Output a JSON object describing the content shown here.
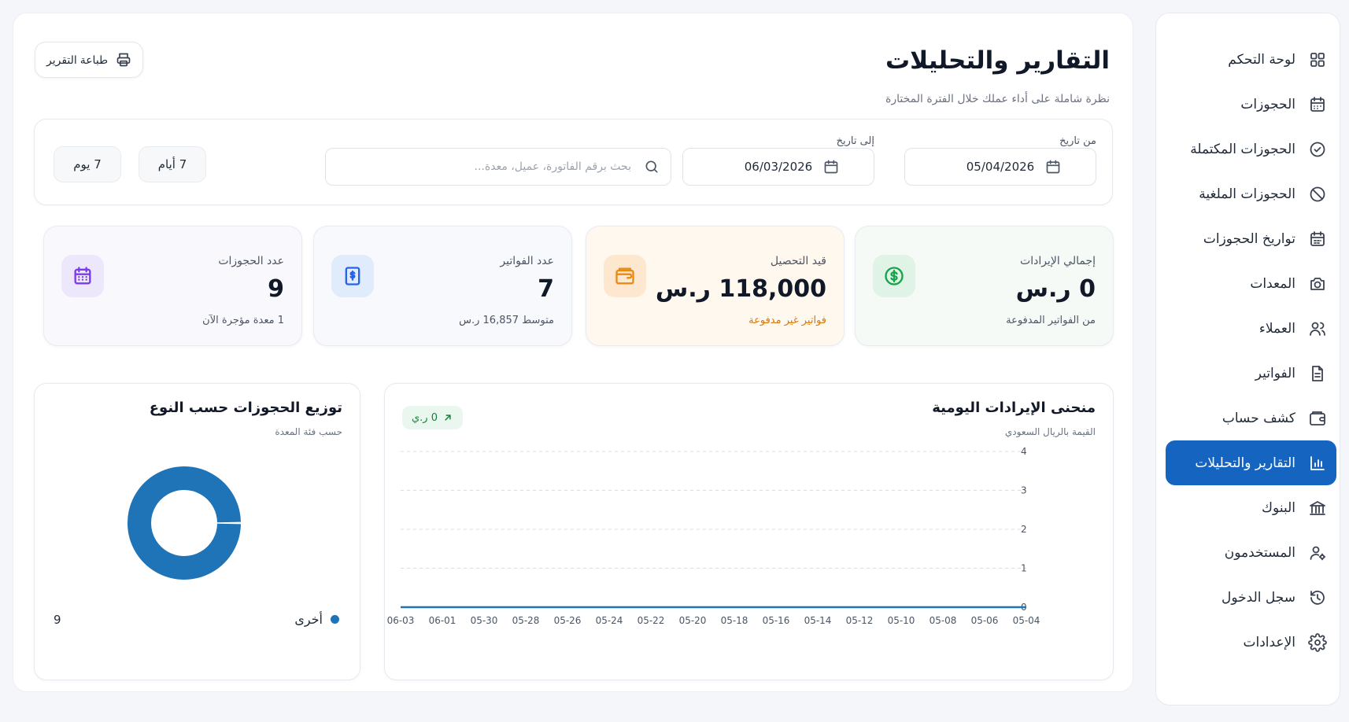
{
  "sidebar": {
    "items": [
      {
        "label": "لوحة التحكم",
        "icon": "dashboard-grid-icon",
        "active": false
      },
      {
        "label": "الحجوزات",
        "icon": "calendar-icon",
        "active": false
      },
      {
        "label": "الحجوزات المكتملة",
        "icon": "check-circle-icon",
        "active": false
      },
      {
        "label": "الحجوزات الملغية",
        "icon": "ban-icon",
        "active": false
      },
      {
        "label": "تواريخ الحجوزات",
        "icon": "calendar-dates-icon",
        "active": false
      },
      {
        "label": "المعدات",
        "icon": "camera-icon",
        "active": false
      },
      {
        "label": "العملاء",
        "icon": "users-icon",
        "active": false
      },
      {
        "label": "الفواتير",
        "icon": "file-text-icon",
        "active": false
      },
      {
        "label": "كشف حساب",
        "icon": "wallet-icon",
        "active": false
      },
      {
        "label": "التقارير والتحليلات",
        "icon": "bar-chart-icon",
        "active": true
      },
      {
        "label": "البنوك",
        "icon": "bank-icon",
        "active": false
      },
      {
        "label": "المستخدمون",
        "icon": "user-cog-icon",
        "active": false
      },
      {
        "label": "سجل الدخول",
        "icon": "history-icon",
        "active": false
      },
      {
        "label": "الإعدادات",
        "icon": "gear-icon",
        "active": false
      }
    ]
  },
  "header": {
    "title": "التقارير والتحليلات",
    "subtitle": "نظرة شاملة على أداء عملك خلال الفترة المختارة",
    "print_label": "طباعة التقرير"
  },
  "filters": {
    "from_label": "من تاريخ",
    "from_value": "05/04/2026",
    "to_label": "إلى تاريخ",
    "to_value": "06/03/2026",
    "search_placeholder": "بحث برقم الفاتورة، عميل، معدة...",
    "quick_7_days": "7 أيام",
    "quick_7_day": "7 يوم"
  },
  "stats": {
    "revenue": {
      "title": "إجمالي الإيرادات",
      "value": "0 ر.س",
      "note": "من الفواتير المدفوعة",
      "icon": "dollar-circle-icon",
      "accent": "#16a34a"
    },
    "pending": {
      "title": "قيد التحصيل",
      "value": "118,000 ر.س",
      "note": "فواتير غير مدفوعة",
      "icon": "wallet-icon",
      "accent": "#ea8a12"
    },
    "invoices": {
      "title": "عدد الفواتير",
      "value": "7",
      "note": "متوسط 16,857 ر.س",
      "icon": "invoice-dollar-icon",
      "accent": "#2563eb"
    },
    "bookings": {
      "title": "عدد الحجوزات",
      "value": "9",
      "note": "1 معدة مؤجرة الآن",
      "icon": "calendar-icon",
      "accent": "#7c3aed"
    }
  },
  "revenue_chart": {
    "title": "منحنى الإيرادات اليومية",
    "subtitle": "القيمة بالريال السعودي",
    "trend_badge": "0 ر.ي"
  },
  "donut_chart": {
    "title": "توزيع الحجوزات حسب النوع",
    "subtitle": "حسب فئة المعدة",
    "legend_label": "أخرى",
    "legend_value": "9"
  },
  "colors": {
    "primary": "#1565c0",
    "series": "#1f73b7"
  },
  "chart_data": [
    {
      "type": "line",
      "x": [
        "06-03",
        "06-01",
        "05-30",
        "05-28",
        "05-26",
        "05-24",
        "05-22",
        "05-20",
        "05-18",
        "05-16",
        "05-14",
        "05-12",
        "05-10",
        "05-08",
        "05-06",
        "05-04"
      ],
      "series": [
        {
          "values": [
            0,
            0,
            0,
            0,
            0,
            0,
            0,
            0,
            0,
            0,
            0,
            0,
            0,
            0,
            0,
            0
          ]
        }
      ],
      "ylim": [
        0,
        4
      ],
      "yticks": [
        0,
        1,
        2,
        3,
        4
      ],
      "grid": true
    },
    {
      "type": "pie",
      "categories": [
        "أخرى"
      ],
      "values": [
        9
      ]
    }
  ]
}
